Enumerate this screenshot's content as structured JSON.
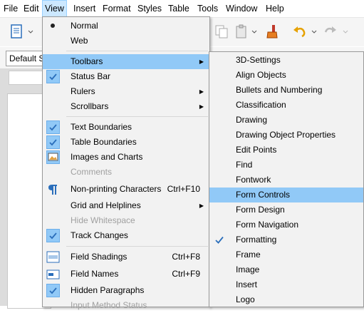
{
  "menubar": {
    "items": [
      "File",
      "Edit",
      "View",
      "Insert",
      "Format",
      "Styles",
      "Table",
      "Tools",
      "Window",
      "Help"
    ],
    "active": "View"
  },
  "toolbar": {
    "paragraph_style": "Default S"
  },
  "view_menu": {
    "items": [
      {
        "label": "Normal",
        "state": "radio"
      },
      {
        "label": "Web"
      },
      {
        "label": "Toolbars",
        "submenu": true,
        "highlighted": true
      },
      {
        "label": "Status Bar",
        "state": "checked"
      },
      {
        "label": "Rulers",
        "submenu": true
      },
      {
        "label": "Scrollbars",
        "submenu": true
      },
      {
        "label": "Text Boundaries",
        "state": "checked"
      },
      {
        "label": "Table Boundaries",
        "state": "checked"
      },
      {
        "label": "Images and Charts",
        "icon": "image-chart-icon"
      },
      {
        "label": "Comments",
        "disabled": true
      },
      {
        "label": "Non-printing Characters",
        "shortcut": "Ctrl+F10",
        "icon": "pilcrow-icon"
      },
      {
        "label": "Grid and Helplines",
        "submenu": true
      },
      {
        "label": "Hide Whitespace",
        "disabled": true
      },
      {
        "label": "Track Changes",
        "state": "checked"
      },
      {
        "label": "Field Shadings",
        "shortcut": "Ctrl+F8",
        "icon": "field-shadings-icon"
      },
      {
        "label": "Field Names",
        "shortcut": "Ctrl+F9",
        "icon": "field-names-icon"
      },
      {
        "label": "Hidden Paragraphs",
        "state": "checked"
      },
      {
        "label": "Input Method Status",
        "disabled": true
      }
    ]
  },
  "toolbars_submenu": {
    "items": [
      {
        "label": "3D-Settings"
      },
      {
        "label": "Align Objects"
      },
      {
        "label": "Bullets and Numbering"
      },
      {
        "label": "Classification"
      },
      {
        "label": "Drawing"
      },
      {
        "label": "Drawing Object Properties"
      },
      {
        "label": "Edit Points"
      },
      {
        "label": "Find"
      },
      {
        "label": "Fontwork"
      },
      {
        "label": "Form Controls",
        "highlighted": true
      },
      {
        "label": "Form Design"
      },
      {
        "label": "Form Navigation"
      },
      {
        "label": "Formatting",
        "state": "checked"
      },
      {
        "label": "Frame"
      },
      {
        "label": "Image"
      },
      {
        "label": "Insert"
      },
      {
        "label": "Logo"
      }
    ]
  },
  "colors": {
    "highlight": "#91c9f7",
    "check_bg": "#91c9f7",
    "menu_bg": "#f2f2f2"
  }
}
